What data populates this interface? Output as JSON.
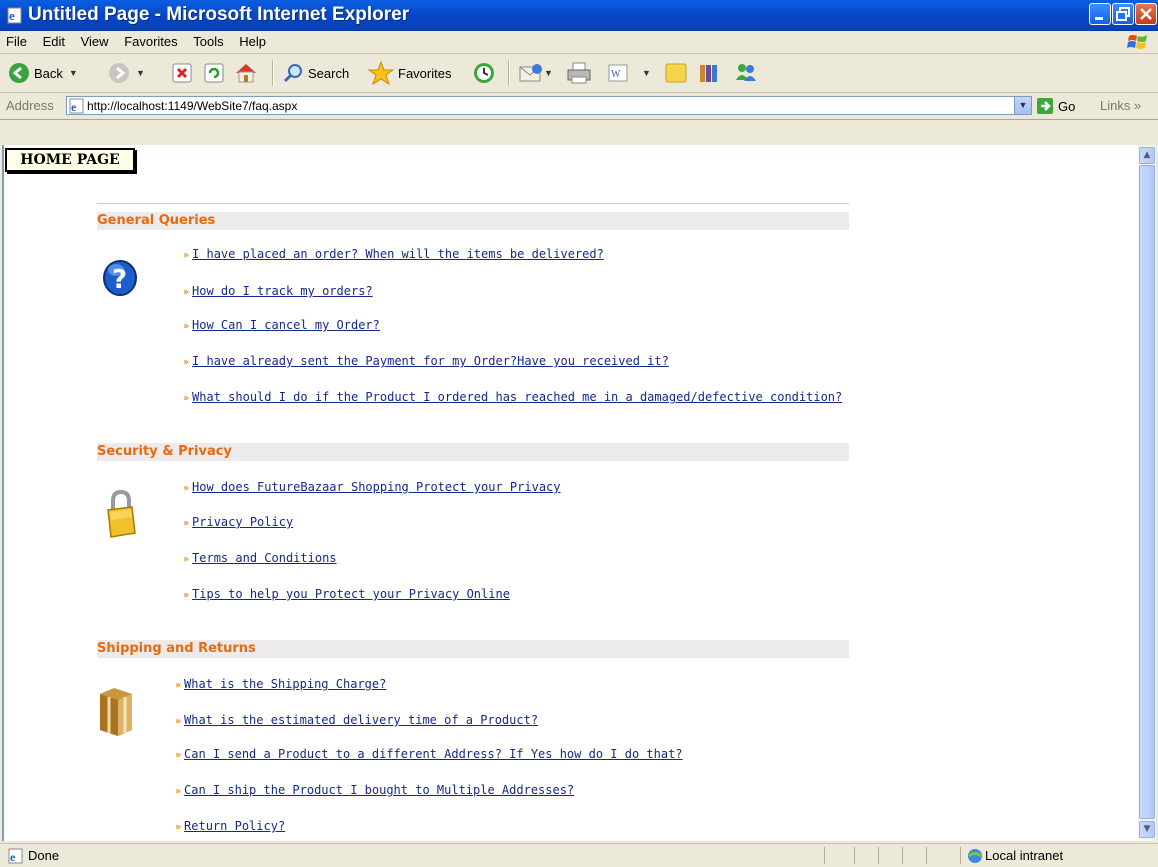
{
  "window": {
    "title": "Untitled Page - Microsoft Internet Explorer"
  },
  "menu": [
    "File",
    "Edit",
    "View",
    "Favorites",
    "Tools",
    "Help"
  ],
  "toolbar": {
    "back": "Back",
    "search": "Search",
    "favorites": "Favorites"
  },
  "address": {
    "label": "Address",
    "url": "http://localhost:1149/WebSite7/faq.aspx",
    "go": "Go",
    "links": "Links"
  },
  "page": {
    "home_button": "HOME PAGE",
    "arrow_glyph": "»",
    "sections": [
      {
        "title": "General Queries",
        "icon": "help-question-icon",
        "items": [
          "I have placed an order? When will the items be delivered?",
          "How do I track my orders?",
          "How Can I cancel my Order?",
          "I have already sent the Payment for my Order?Have you received it?",
          "What should I do if the Product I ordered has reached me in a damaged/defective condition?"
        ]
      },
      {
        "title": "Security & Privacy",
        "icon": "padlock-icon",
        "items": [
          "How does FutureBazaar Shopping Protect your Privacy",
          "Privacy Policy",
          "Terms and Conditions",
          "Tips to help you Protect your Privacy Online"
        ]
      },
      {
        "title": "Shipping and Returns",
        "icon": "package-box-icon",
        "items": [
          "What is the Shipping Charge?",
          "What is the estimated delivery time of a Product?",
          "Can I send a Product to a different Address? If Yes how do I do that?",
          "Can I ship the Product I bought to Multiple Addresses?",
          "Return Policy?"
        ]
      }
    ]
  },
  "status": {
    "text": "Done",
    "zone": "Local intranet"
  },
  "colors": {
    "section_heading": "#e86a10",
    "link": "#16298a",
    "arrow": "#f08a14",
    "section_bg": "#eceaea"
  }
}
